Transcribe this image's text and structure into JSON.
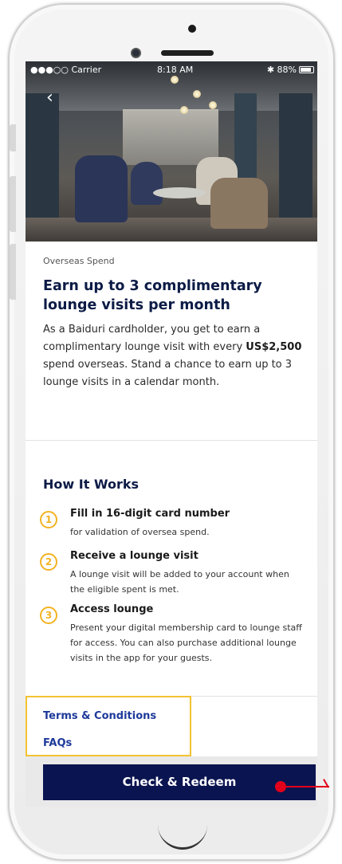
{
  "status_bar": {
    "carrier": "●●●○○ Carrier",
    "time": "8:18 AM",
    "battery": "88%"
  },
  "nav": {
    "back_icon": "chevron-left-icon",
    "back_glyph": "‹"
  },
  "offer": {
    "category": "Overseas Spend",
    "title": "Earn up to 3 complimentary lounge visits per month",
    "description_prefix": "As a Baiduri cardholder, you get to earn a complimentary lounge visit with every ",
    "description_amount": "US$2,500",
    "description_suffix": " spend overseas. Stand a chance to earn up to 3 lounge visits in a calendar month."
  },
  "how_it_works": {
    "title": "How It Works",
    "steps": [
      {
        "number": "1",
        "title": "Fill in 16-digit card number",
        "description": "for validation of oversea spend."
      },
      {
        "number": "2",
        "title": "Receive a lounge visit",
        "description": "A lounge visit will be added to your account when the eligible spent is met."
      },
      {
        "number": "3",
        "title": "Access lounge",
        "description": "Present your digital membership card to lounge staff for access. You can also purchase additional lounge visits in the app for your guests."
      }
    ]
  },
  "links": {
    "terms": "Terms & Conditions",
    "faqs": "FAQs"
  },
  "footer": {
    "cta_label": "Check & Redeem"
  },
  "colors": {
    "primary": "#0a1450",
    "accent": "#f3b323",
    "link": "#1e3a9a",
    "annotation": "#e3001b"
  }
}
